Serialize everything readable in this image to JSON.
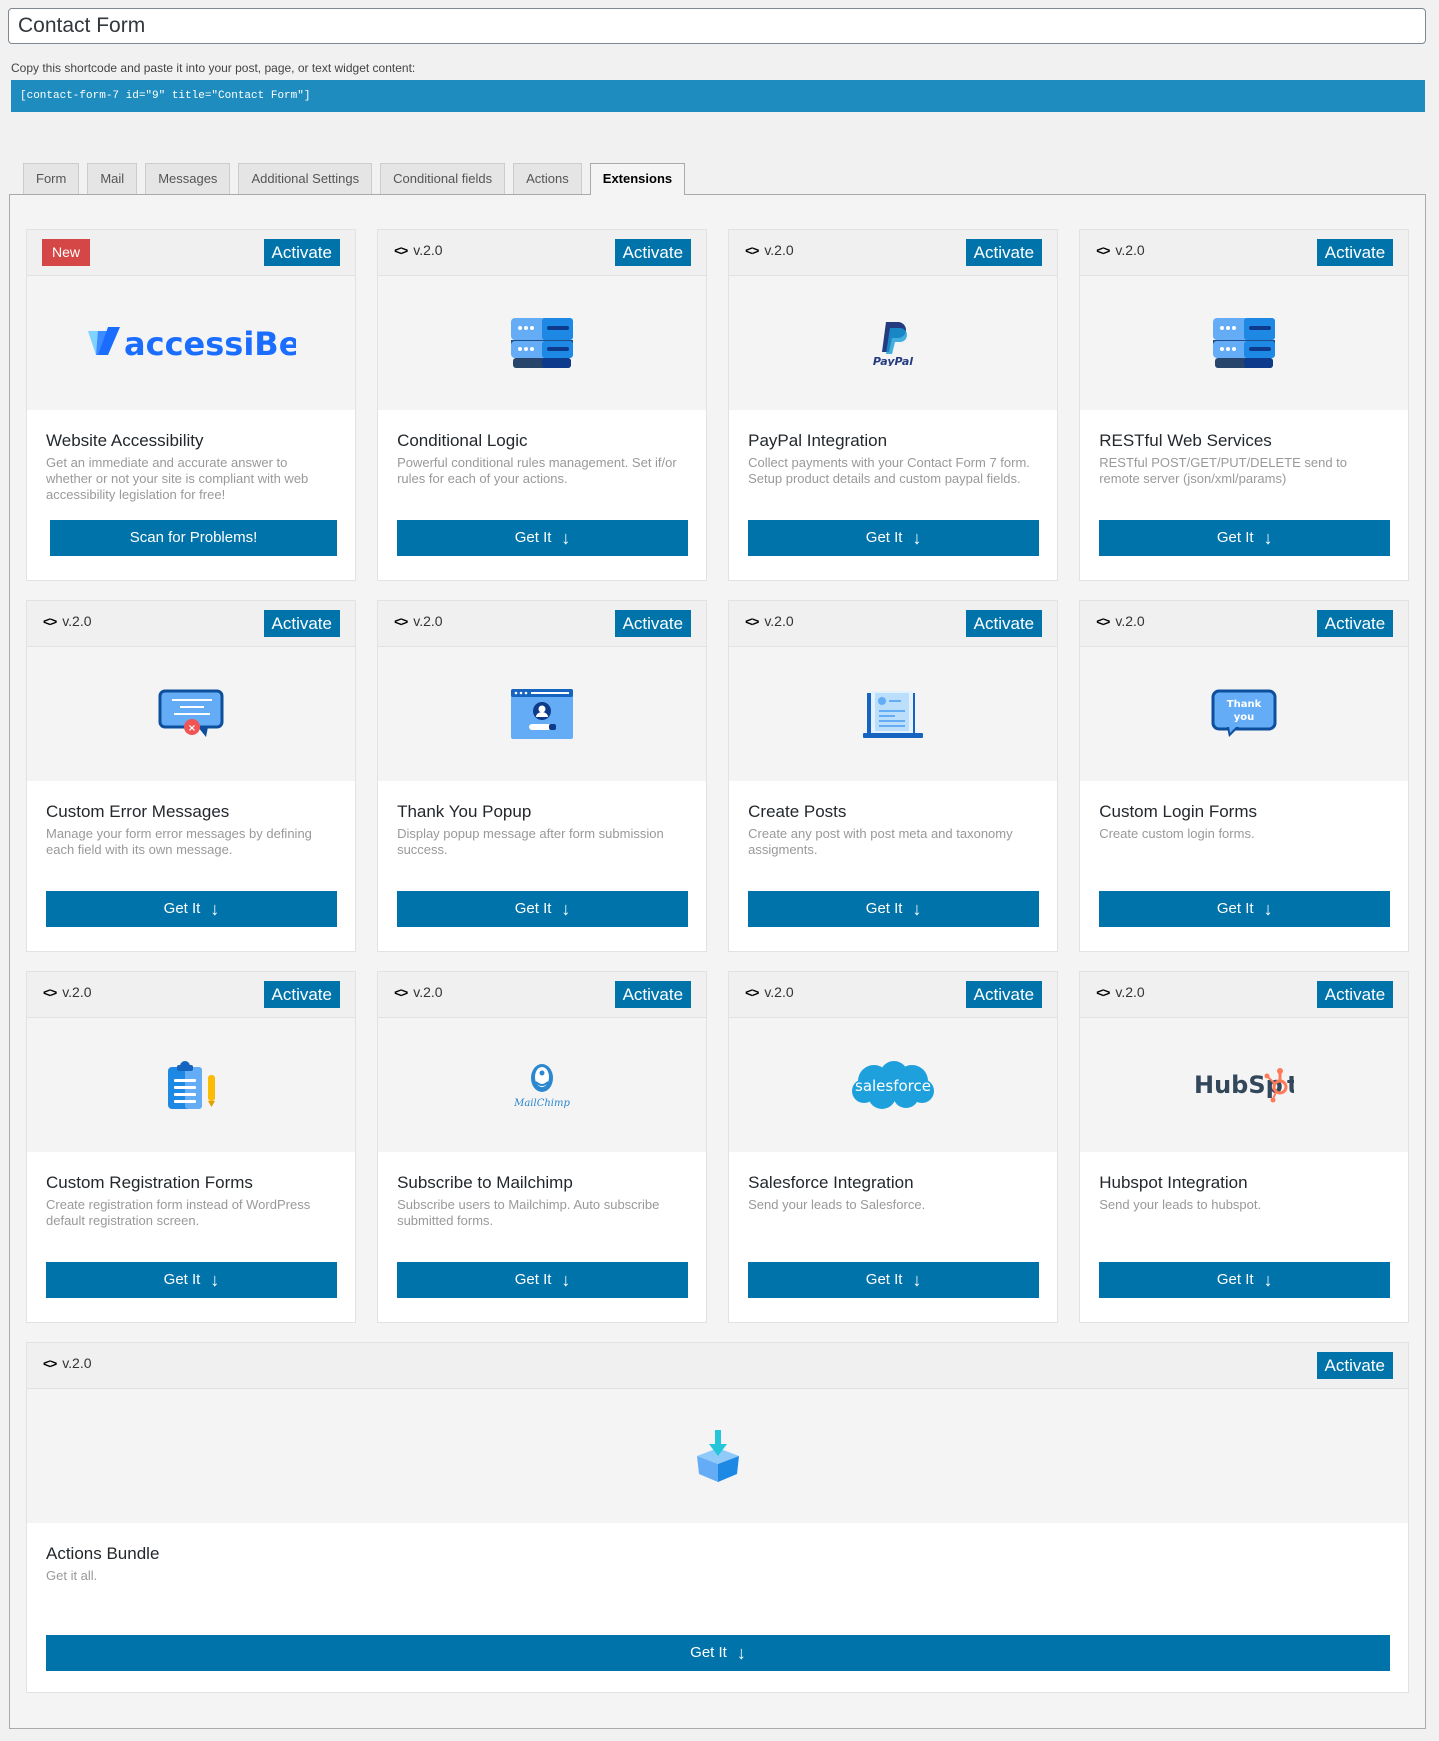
{
  "title_input": {
    "value": "Contact Form"
  },
  "shortcode": {
    "helper": "Copy this shortcode and paste it into your post, page, or text widget content:",
    "code": "[contact-form-7 id=\"9\" title=\"Contact Form\"]"
  },
  "tabs": [
    {
      "label": "Form",
      "active": false
    },
    {
      "label": "Mail",
      "active": false
    },
    {
      "label": "Messages",
      "active": false
    },
    {
      "label": "Additional Settings",
      "active": false
    },
    {
      "label": "Conditional fields",
      "active": false
    },
    {
      "label": "Actions",
      "active": false
    },
    {
      "label": "Extensions",
      "active": true
    }
  ],
  "colors": {
    "primary": "#0073aa",
    "shortcode_bg": "#1e8cbe",
    "new_badge": "#d54646"
  },
  "activate_label": "Activate",
  "get_it_label": "Get It",
  "cards": [
    {
      "badge": "New",
      "version": null,
      "icon": "accessibe-logo",
      "logo_text": "accessiBe",
      "title": "Website Accessibility",
      "description": "Get an immediate and accurate answer to whether or not your site is compliant with web accessibility legislation for free!",
      "button": "Scan for Problems!"
    },
    {
      "badge": null,
      "version": "v.2.0",
      "icon": "server-stack-icon",
      "title": "Conditional Logic",
      "description": "Powerful conditional rules management. Set if/or rules for each of your actions.",
      "button": "Get It"
    },
    {
      "badge": null,
      "version": "v.2.0",
      "icon": "paypal-logo",
      "logo_text": "PayPal",
      "title": "PayPal Integration",
      "description": "Collect payments with your Contact Form 7 form. Setup product details and custom paypal fields.",
      "button": "Get It"
    },
    {
      "badge": null,
      "version": "v.2.0",
      "icon": "server-stack-icon",
      "title": "RESTful Web Services",
      "description": "RESTful POST/GET/PUT/DELETE send to remote server (json/xml/params)",
      "button": "Get It"
    },
    {
      "badge": null,
      "version": "v.2.0",
      "icon": "error-message-icon",
      "title": "Custom Error Messages",
      "description": "Manage your form error messages by defining each field with its own message.",
      "button": "Get It"
    },
    {
      "badge": null,
      "version": "v.2.0",
      "icon": "popup-window-icon",
      "title": "Thank You Popup",
      "description": "Display popup message after form submission success.",
      "button": "Get It"
    },
    {
      "badge": null,
      "version": "v.2.0",
      "icon": "laptop-post-icon",
      "title": "Create Posts",
      "description": "Create any post with post meta and taxonomy assigments.",
      "button": "Get It"
    },
    {
      "badge": null,
      "version": "v.2.0",
      "icon": "thank-you-bubble-icon",
      "logo_text": "Thank you",
      "title": "Custom Login Forms",
      "description": "Create custom login forms.",
      "button": "Get It"
    },
    {
      "badge": null,
      "version": "v.2.0",
      "icon": "clipboard-icon",
      "title": "Custom Registration Forms",
      "description": "Create registration form instead of WordPress default registration screen.",
      "button": "Get It"
    },
    {
      "badge": null,
      "version": "v.2.0",
      "icon": "mailchimp-logo",
      "logo_text": "MailChimp",
      "title": "Subscribe to Mailchimp",
      "description": "Subscribe users to Mailchimp. Auto subscribe submitted forms.",
      "button": "Get It"
    },
    {
      "badge": null,
      "version": "v.2.0",
      "icon": "salesforce-logo",
      "logo_text": "salesforce",
      "title": "Salesforce Integration",
      "description": "Send your leads to Salesforce.",
      "button": "Get It"
    },
    {
      "badge": null,
      "version": "v.2.0",
      "icon": "hubspot-logo",
      "logo_text": "HubSpot",
      "title": "Hubspot Integration",
      "description": "Send your leads to hubspot.",
      "button": "Get It"
    }
  ],
  "bundle": {
    "version": "v.2.0",
    "icon": "box-download-icon",
    "title": "Actions Bundle",
    "description": "Get it all.",
    "button": "Get It"
  }
}
